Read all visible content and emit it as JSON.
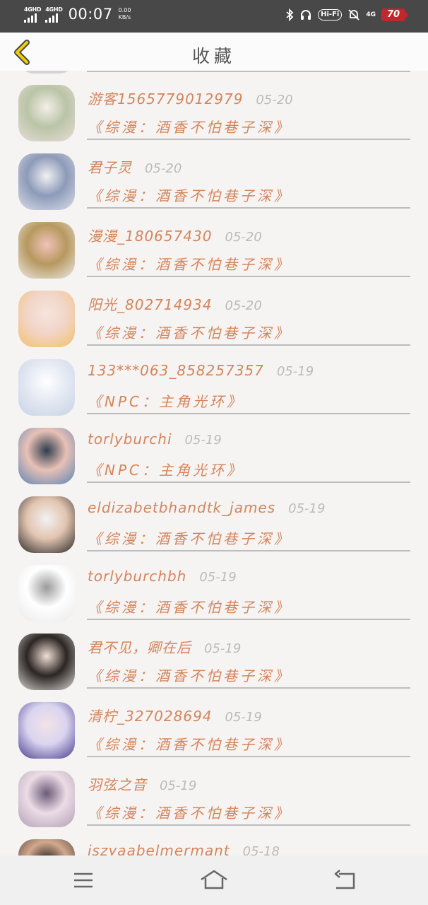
{
  "status_bar": {
    "sim1": "4GHD",
    "sim2": "4GHD",
    "time": "00:07",
    "speed_value": "0.00",
    "speed_unit": "KB/s",
    "hifi": "Hi-Fi",
    "network": "4G",
    "battery": "70"
  },
  "header": {
    "title": "收藏",
    "back_icon": "chevron-left-icon"
  },
  "items": [
    {
      "name": "游客1565779012979",
      "date": "05-20",
      "title": "《综漫：酒香不怕巷子深》",
      "avatar_colors": [
        "#e8ddd6",
        "#b9c4a6",
        "#f4eee8"
      ]
    },
    {
      "name": "君子灵",
      "date": "05-20",
      "title": "《综漫：酒香不怕巷子深》",
      "avatar_colors": [
        "#d9dde8",
        "#8d9ab8",
        "#f1f1f4"
      ]
    },
    {
      "name": "漫漫_180657430",
      "date": "05-20",
      "title": "《综漫：酒香不怕巷子深》",
      "avatar_colors": [
        "#eceae5",
        "#b7985f",
        "#f0c3b8"
      ]
    },
    {
      "name": "阳光_802714934",
      "date": "05-20",
      "title": "《综漫：酒香不怕巷子深》",
      "avatar_colors": [
        "#f3c06c",
        "#f1d5c8",
        "#f7e4dc"
      ]
    },
    {
      "name": "133***063_858257357",
      "date": "05-19",
      "title": "《NPC：主角光环》",
      "avatar_colors": [
        "#c8d2e6",
        "#e4e9f2",
        "#ffffff"
      ]
    },
    {
      "name": "torlyburchi",
      "date": "05-19",
      "title": "《NPC：主角光环》",
      "avatar_colors": [
        "#5d84b4",
        "#e8c1b6",
        "#2f3e4f"
      ]
    },
    {
      "name": "eldizabetbhandtk_james",
      "date": "05-19",
      "title": "《综漫：酒香不怕巷子深》",
      "avatar_colors": [
        "#2a2a2a",
        "#e2c4b0",
        "#f2f2f2"
      ]
    },
    {
      "name": "torlyburchbh",
      "date": "05-19",
      "title": "《综漫：酒香不怕巷子深》",
      "avatar_colors": [
        "#e9e9e9",
        "#ffffff",
        "#9a9a9a"
      ]
    },
    {
      "name": "君不见，卿在后",
      "date": "05-19",
      "title": "《综漫：酒香不怕巷子深》",
      "avatar_colors": [
        "#d7d5d2",
        "#2b2523",
        "#f1dfd6"
      ]
    },
    {
      "name": "清柠_327028694",
      "date": "05-19",
      "title": "《综漫：酒香不怕巷子深》",
      "avatar_colors": [
        "#4a3f8e",
        "#d9d4f0",
        "#f3e3e6"
      ]
    },
    {
      "name": "羽弦之音",
      "date": "05-19",
      "title": "《综漫：酒香不怕巷子深》",
      "avatar_colors": [
        "#b2a0b4",
        "#ecdce6",
        "#6c5b78"
      ]
    },
    {
      "name": "iszyaabelmermant",
      "date": "05-18",
      "title": "",
      "avatar_colors": [
        "#3e2f2b",
        "#d1a98d",
        "#1c1c1c"
      ]
    }
  ],
  "nav": {
    "menu_icon": "menu-icon",
    "home_icon": "home-icon",
    "back_icon": "back-icon"
  }
}
